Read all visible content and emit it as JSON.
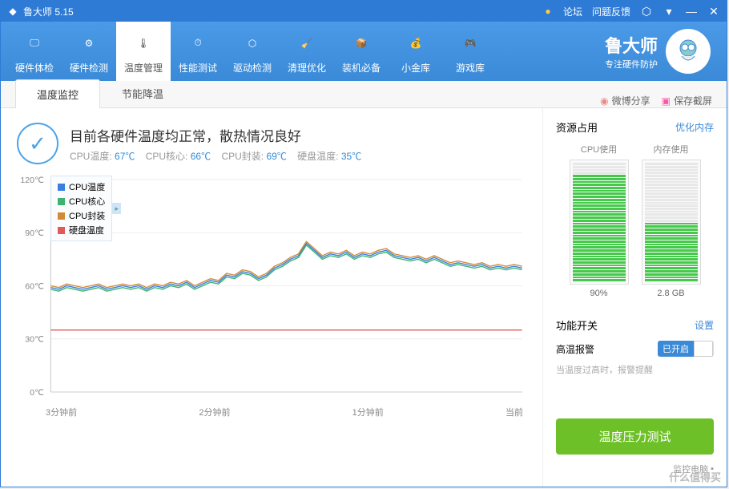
{
  "app_title": "鲁大师 5.15",
  "titlebar_links": {
    "forum": "论坛",
    "feedback": "问题反馈"
  },
  "toolbar": [
    {
      "id": "hw-check",
      "label": "硬件体检"
    },
    {
      "id": "hw-detect",
      "label": "硬件检测"
    },
    {
      "id": "temp-mgmt",
      "label": "温度管理"
    },
    {
      "id": "perf-test",
      "label": "性能测试"
    },
    {
      "id": "drv-detect",
      "label": "驱动检测"
    },
    {
      "id": "cleanup",
      "label": "清理优化"
    },
    {
      "id": "essentials",
      "label": "装机必备"
    },
    {
      "id": "vault",
      "label": "小金库"
    },
    {
      "id": "gamelib",
      "label": "游戏库"
    }
  ],
  "brand": {
    "title": "鲁大师",
    "subtitle": "专注硬件防护"
  },
  "tabs": [
    {
      "id": "monitor",
      "label": "温度监控"
    },
    {
      "id": "cooling",
      "label": "节能降温"
    }
  ],
  "tabbar_right": {
    "weibo": "微博分享",
    "screenshot": "保存截屏"
  },
  "status": {
    "headline": "目前各硬件温度均正常，散热情况良好",
    "cpu_temp_label": "CPU温度:",
    "cpu_temp_val": "67℃",
    "cpu_core_label": "CPU核心:",
    "cpu_core_val": "66℃",
    "cpu_pkg_label": "CPU封装:",
    "cpu_pkg_val": "69℃",
    "hdd_temp_label": "硬盘温度:",
    "hdd_temp_val": "35℃"
  },
  "legend": [
    {
      "label": "CPU温度",
      "color": "#3a7fe0"
    },
    {
      "label": "CPU核心",
      "color": "#3cb371"
    },
    {
      "label": "CPU封装",
      "color": "#d28a3a"
    },
    {
      "label": "硬盘温度",
      "color": "#e05a5a"
    }
  ],
  "resource": {
    "title": "资源占用",
    "optimize": "优化内存",
    "cpu_label": "CPU使用",
    "cpu_val": "90%",
    "cpu_pct": 90,
    "mem_label": "内存使用",
    "mem_val": "2.8 GB",
    "mem_pct": 50
  },
  "switches": {
    "title": "功能开关",
    "settings": "设置",
    "alarm_label": "高温报警",
    "alarm_on": "已开启",
    "alarm_hint": "当温度过高时，报警提醒"
  },
  "test_button": "温度压力测试",
  "footer": "监控电脑",
  "watermark": "什么值得买",
  "chart_data": {
    "type": "line",
    "xlabel": "",
    "ylabel": "",
    "ylim": [
      0,
      120
    ],
    "x_ticks": [
      "3分钟前",
      "2分钟前",
      "1分钟前",
      "当前"
    ],
    "y_ticks": [
      0,
      30,
      60,
      90,
      120
    ],
    "x": [
      0,
      1,
      2,
      3,
      4,
      5,
      6,
      7,
      8,
      9,
      10,
      11,
      12,
      13,
      14,
      15,
      16,
      17,
      18,
      19,
      20,
      21,
      22,
      23,
      24,
      25,
      26,
      27,
      28,
      29,
      30,
      31,
      32,
      33,
      34,
      35,
      36,
      37,
      38,
      39,
      40,
      41,
      42,
      43,
      44,
      45,
      46,
      47,
      48,
      49,
      50,
      51,
      52,
      53,
      54,
      55,
      56,
      57,
      58,
      59
    ],
    "series": [
      {
        "name": "CPU温度",
        "color": "#3a7fe0",
        "values": [
          59,
          58,
          60,
          59,
          58,
          59,
          60,
          58,
          59,
          60,
          59,
          60,
          58,
          60,
          59,
          61,
          60,
          62,
          59,
          61,
          63,
          62,
          66,
          65,
          68,
          67,
          64,
          66,
          70,
          72,
          75,
          77,
          84,
          80,
          76,
          78,
          77,
          79,
          76,
          78,
          77,
          79,
          80,
          77,
          76,
          75,
          76,
          74,
          76,
          74,
          72,
          73,
          72,
          71,
          72,
          70,
          71,
          70,
          71,
          70
        ]
      },
      {
        "name": "CPU核心",
        "color": "#3cb371",
        "values": [
          58,
          57,
          59,
          58,
          57,
          58,
          59,
          57,
          58,
          59,
          58,
          59,
          57,
          59,
          58,
          60,
          59,
          61,
          58,
          60,
          62,
          61,
          65,
          64,
          67,
          66,
          63,
          65,
          69,
          71,
          74,
          76,
          83,
          79,
          75,
          77,
          76,
          78,
          75,
          77,
          76,
          78,
          79,
          76,
          75,
          74,
          75,
          73,
          75,
          73,
          71,
          72,
          71,
          70,
          71,
          69,
          70,
          69,
          70,
          69
        ]
      },
      {
        "name": "CPU封装",
        "color": "#d28a3a",
        "values": [
          60,
          59,
          61,
          60,
          59,
          60,
          61,
          59,
          60,
          61,
          60,
          61,
          59,
          61,
          60,
          62,
          61,
          63,
          60,
          62,
          64,
          63,
          67,
          66,
          69,
          68,
          65,
          67,
          71,
          73,
          76,
          78,
          85,
          81,
          77,
          79,
          78,
          80,
          77,
          79,
          78,
          80,
          81,
          78,
          77,
          76,
          77,
          75,
          77,
          75,
          73,
          74,
          73,
          72,
          73,
          71,
          72,
          71,
          72,
          71
        ]
      },
      {
        "name": "硬盘温度",
        "color": "#e05a5a",
        "values": [
          35,
          35,
          35,
          35,
          35,
          35,
          35,
          35,
          35,
          35,
          35,
          35,
          35,
          35,
          35,
          35,
          35,
          35,
          35,
          35,
          35,
          35,
          35,
          35,
          35,
          35,
          35,
          35,
          35,
          35,
          35,
          35,
          35,
          35,
          35,
          35,
          35,
          35,
          35,
          35,
          35,
          35,
          35,
          35,
          35,
          35,
          35,
          35,
          35,
          35,
          35,
          35,
          35,
          35,
          35,
          35,
          35,
          35,
          35,
          35
        ]
      }
    ]
  }
}
